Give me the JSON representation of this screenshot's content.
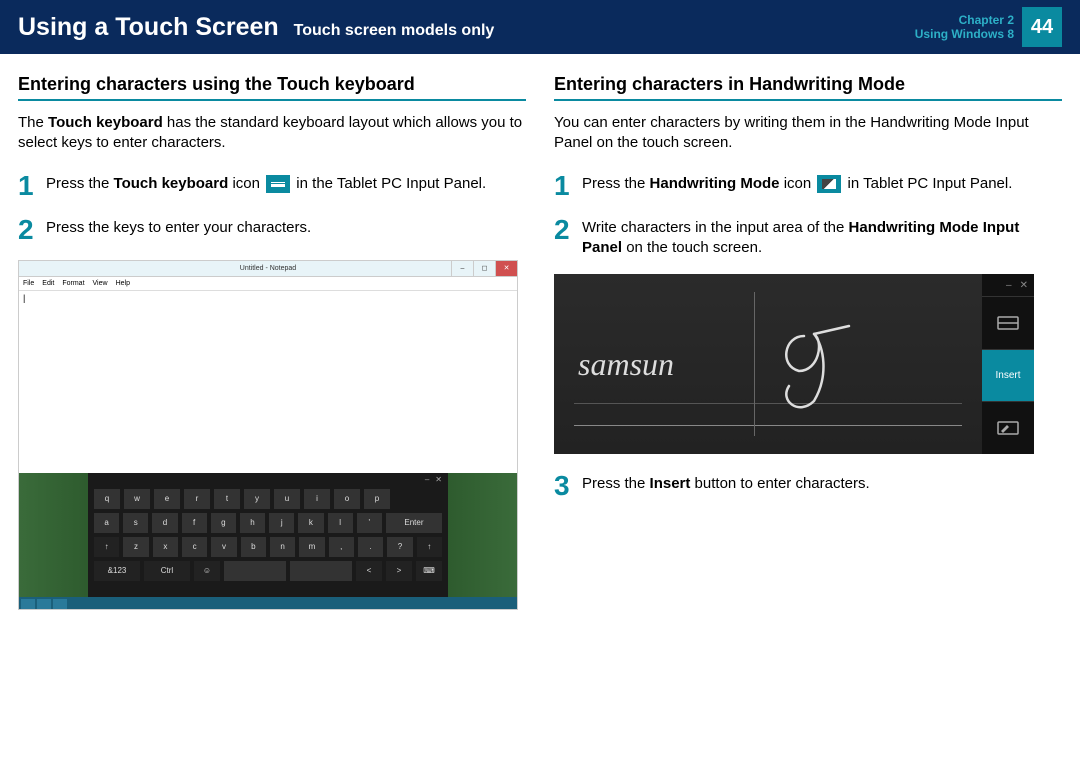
{
  "header": {
    "title": "Using a Touch Screen",
    "subtitle": "Touch screen models only",
    "chapter": "Chapter 2",
    "context": "Using Windows 8",
    "page": "44"
  },
  "left": {
    "heading": "Entering characters using the Touch keyboard",
    "intro_pre": "The ",
    "intro_bold": "Touch keyboard",
    "intro_post": " has the standard keyboard layout which allows you to select keys to enter characters.",
    "step1_a": "Press the ",
    "step1_b": "Touch keyboard",
    "step1_c": " icon ",
    "step1_d": " in the Tablet PC Input Panel.",
    "step2": "Press the keys to enter your characters.",
    "notepad": {
      "title": "Untitled - Notepad",
      "menus": [
        "File",
        "Edit",
        "Format",
        "View",
        "Help"
      ],
      "cursor": "|"
    },
    "keyboard_rows": [
      [
        "q",
        "w",
        "e",
        "r",
        "t",
        "y",
        "u",
        "i",
        "o",
        "p"
      ],
      [
        "a",
        "s",
        "d",
        "f",
        "g",
        "h",
        "j",
        "k",
        "l",
        "'",
        "Enter"
      ],
      [
        "↑",
        "z",
        "x",
        "c",
        "v",
        "b",
        "n",
        "m",
        ",",
        ".",
        "?",
        "↑"
      ],
      [
        "&123",
        "Ctrl",
        "☺",
        "",
        "",
        "<",
        ">",
        "⌨"
      ]
    ]
  },
  "right": {
    "heading": "Entering characters in Handwriting Mode",
    "intro": "You can enter characters by writing them in the Handwriting Mode Input Panel on the touch screen.",
    "step1_a": "Press the ",
    "step1_b": "Handwriting Mode",
    "step1_c": " icon ",
    "step1_d": " in Tablet PC Input Panel.",
    "step2_a": "Write characters in the input area of the ",
    "step2_b": "Handwriting Mode Input Panel",
    "step2_c": " on the touch screen.",
    "step3_a": "Press the ",
    "step3_b": "Insert",
    "step3_c": " button to enter characters.",
    "hw": {
      "sample": "samsun",
      "insert": "Insert"
    }
  }
}
